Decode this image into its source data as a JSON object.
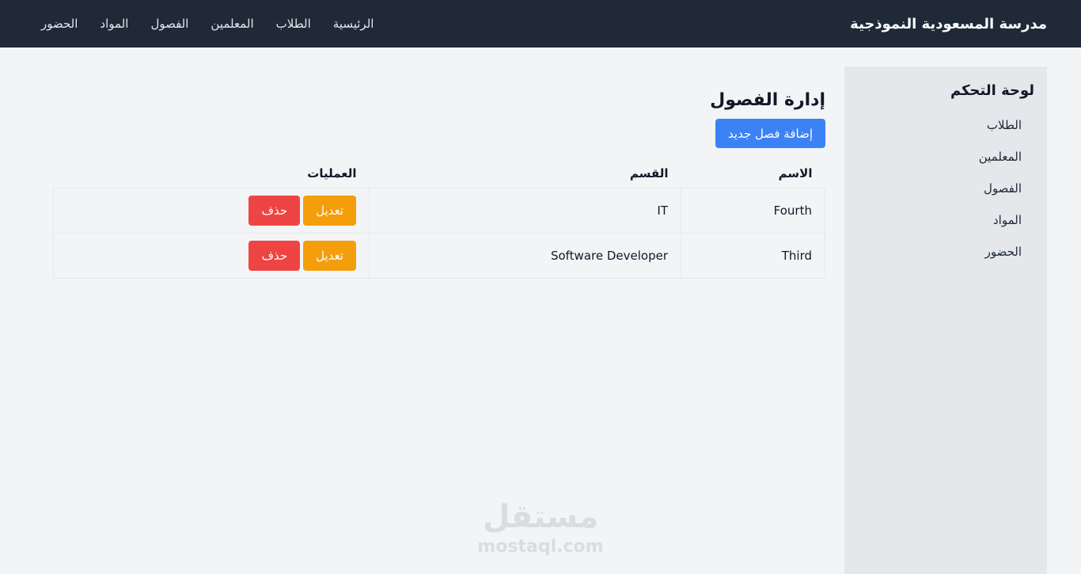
{
  "navbar": {
    "brand": "مدرسة المسعودية النموذجية",
    "links": [
      "الرئيسية",
      "الطلاب",
      "المعلمين",
      "الفصول",
      "المواد",
      "الحضور"
    ]
  },
  "sidebar": {
    "title": "لوحة التحكم",
    "items": [
      "الطلاب",
      "المعلمين",
      "الفصول",
      "المواد",
      "الحضور"
    ]
  },
  "main": {
    "title": "إدارة الفصول",
    "add_button": "إضافة فصل جديد",
    "table": {
      "headers": [
        "الاسم",
        "القسم",
        "العمليات"
      ],
      "rows": [
        {
          "name": "Fourth",
          "department": "IT"
        },
        {
          "name": "Third",
          "department": "Software Developer"
        }
      ],
      "edit_label": "تعديل",
      "delete_label": "حذف"
    }
  },
  "watermark": {
    "arabic": "مستقل",
    "latin": "mostaql.com"
  },
  "colors": {
    "navbar": "#1f2937",
    "primary": "#3b82f6",
    "edit": "#f59e0b",
    "delete": "#ef4444",
    "sidebar": "#e5e7eb",
    "background": "#f3f4f6"
  }
}
